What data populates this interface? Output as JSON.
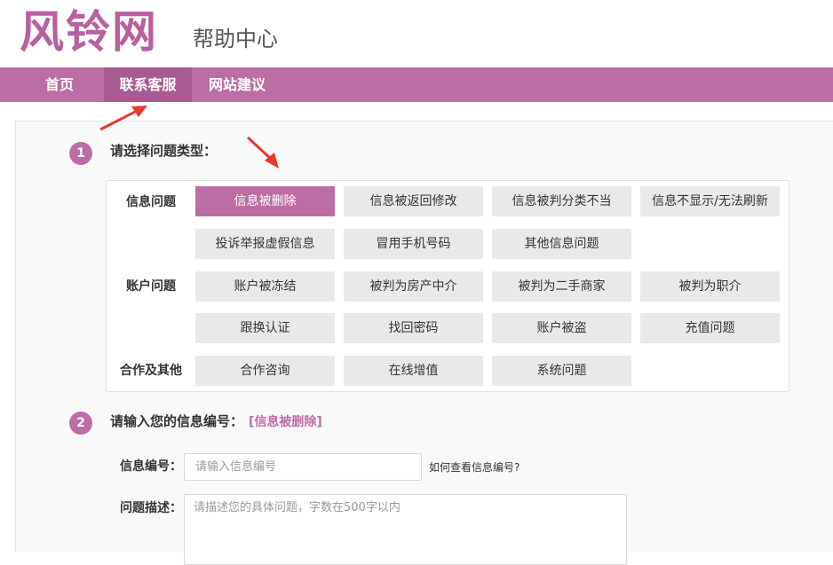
{
  "header": {
    "logo": "风铃网",
    "subtitle": "帮助中心"
  },
  "nav": {
    "items": [
      {
        "label": "首页"
      },
      {
        "label": "联系客服",
        "active": true
      },
      {
        "label": "网站建议"
      }
    ]
  },
  "step1": {
    "number": "1",
    "title": "请选择问题类型：",
    "categories": {
      "info": "信息问题",
      "account": "账户问题",
      "other": "合作及其他"
    },
    "options": [
      "信息被删除",
      "信息被返回修改",
      "信息被判分类不当",
      "信息不显示/无法刷新",
      "投诉举报虚假信息",
      "冒用手机号码",
      "其他信息问题",
      "账户被冻结",
      "被判为房产中介",
      "被判为二手商家",
      "被判为职介",
      "跟换认证",
      "找回密码",
      "账户被盗",
      "充值问题",
      "合作咨询",
      "在线增值",
      "系统问题"
    ],
    "selected": "信息被删除"
  },
  "step2": {
    "number": "2",
    "title": "请输入您的信息编号：",
    "tag": "[信息被删除]",
    "info_id_label": "信息编号：",
    "info_id_placeholder": "请输入信息编号",
    "help_link": "如何查看信息编号?",
    "desc_label": "问题描述：",
    "desc_placeholder": "请描述您的具体问题，字数在500字以内"
  },
  "colors": {
    "accent": "#bd6da6",
    "nav_active": "#a75b92",
    "annotation_arrow": "#e8382f"
  }
}
